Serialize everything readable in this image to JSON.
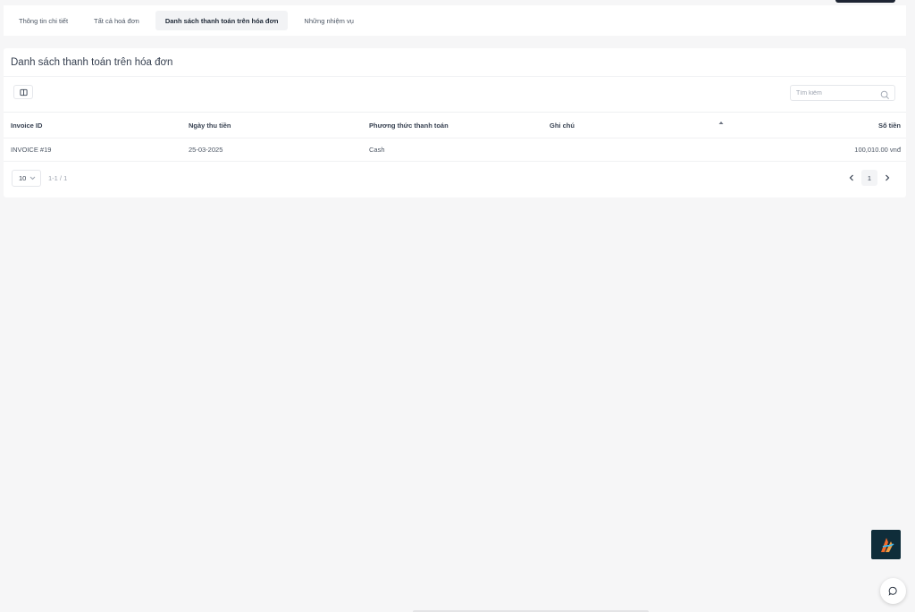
{
  "tabs": [
    {
      "label": "Thông tin chi tiết",
      "active": false
    },
    {
      "label": "Tất cả hoá đơn",
      "active": false
    },
    {
      "label": "Danh sách thanh toán trên hóa đơn",
      "active": true
    },
    {
      "label": "Những nhiệm vụ",
      "active": false
    }
  ],
  "card": {
    "title": "Danh sách thanh toán trên hóa đơn",
    "search_placeholder": "Tìm kiếm"
  },
  "table": {
    "columns": [
      "Invoice ID",
      "Ngày thu tiền",
      "Phương thức thanh toán",
      "Ghi chú",
      "Số tiền"
    ],
    "rows": [
      {
        "invoice_id": "INVOICE #19",
        "date": "25-03-2025",
        "method": "Cash",
        "note": "",
        "amount": "100,010.00 vnđ"
      }
    ]
  },
  "pagination": {
    "page_size": "10",
    "range": "1-1 / 1",
    "current_page": "1"
  },
  "icons": {
    "columns": "columns-icon",
    "search": "search-icon",
    "sort": "sort-asc-icon",
    "prev": "chevron-left-icon",
    "next": "chevron-right-icon",
    "chat": "chat-bubble-icon"
  },
  "colors": {
    "accent_dark": "#1e2533",
    "badge_bg": "#0f2d3a",
    "badge_orange": "#f26b2b"
  }
}
